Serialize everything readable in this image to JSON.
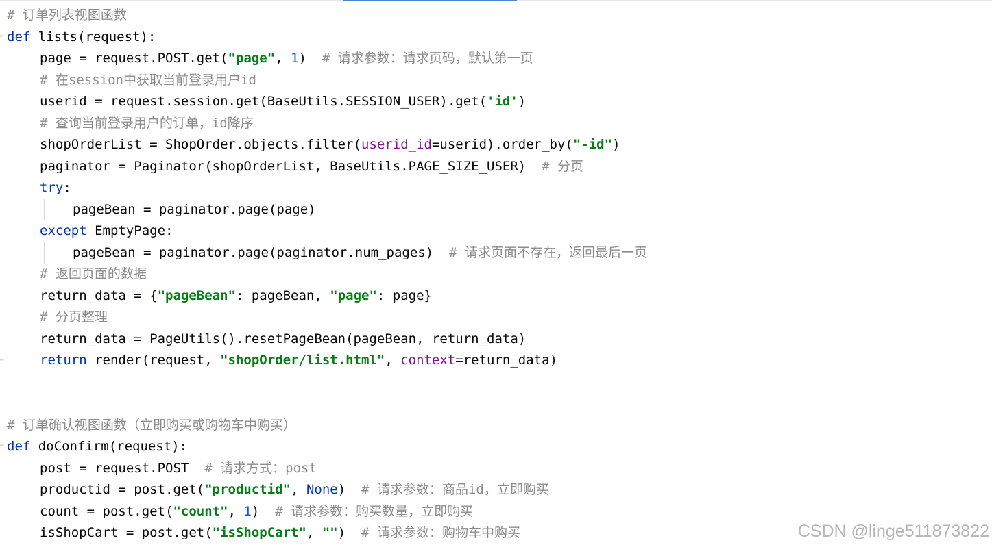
{
  "editor": {
    "lines": [
      {
        "indent": 0,
        "marker": "",
        "guide": false,
        "tokens": [
          {
            "t": "# ",
            "c": "cmt-en"
          },
          {
            "t": "订单列表视图函数",
            "c": "cmt"
          }
        ]
      },
      {
        "indent": 0,
        "marker": "fold",
        "guide": false,
        "tokens": [
          {
            "t": "def",
            "c": "kw"
          },
          {
            "t": " lists(request):",
            "c": ""
          }
        ]
      },
      {
        "indent": 1,
        "marker": "",
        "guide": false,
        "tokens": [
          {
            "t": "page = request.POST.get(",
            "c": ""
          },
          {
            "t": "\"page\"",
            "c": "str"
          },
          {
            "t": ", ",
            "c": ""
          },
          {
            "t": "1",
            "c": "num"
          },
          {
            "t": ")  ",
            "c": ""
          },
          {
            "t": "# ",
            "c": "cmt-en"
          },
          {
            "t": "请求参数：请求页码，默认第一页",
            "c": "cmt"
          }
        ]
      },
      {
        "indent": 1,
        "marker": "",
        "guide": false,
        "tokens": [
          {
            "t": "# ",
            "c": "cmt-en"
          },
          {
            "t": "在",
            "c": "cmt"
          },
          {
            "t": "session",
            "c": "cmt-en"
          },
          {
            "t": "中获取当前登录用户",
            "c": "cmt"
          },
          {
            "t": "id",
            "c": "cmt-en"
          }
        ]
      },
      {
        "indent": 1,
        "marker": "",
        "guide": false,
        "tokens": [
          {
            "t": "userid = request.session.get(BaseUtils.SESSION_USER).get(",
            "c": ""
          },
          {
            "t": "'id'",
            "c": "str"
          },
          {
            "t": ")",
            "c": ""
          }
        ]
      },
      {
        "indent": 1,
        "marker": "",
        "guide": false,
        "tokens": [
          {
            "t": "# ",
            "c": "cmt-en"
          },
          {
            "t": "查询当前登录用户的订单，",
            "c": "cmt"
          },
          {
            "t": "id",
            "c": "cmt-en"
          },
          {
            "t": "降序",
            "c": "cmt"
          }
        ]
      },
      {
        "indent": 1,
        "marker": "",
        "guide": false,
        "tokens": [
          {
            "t": "shopOrderList = ShopOrder.objects.filter(",
            "c": ""
          },
          {
            "t": "userid_id",
            "c": "prm"
          },
          {
            "t": "=userid).order_by(",
            "c": ""
          },
          {
            "t": "\"-id\"",
            "c": "str"
          },
          {
            "t": ")",
            "c": ""
          }
        ]
      },
      {
        "indent": 1,
        "marker": "",
        "guide": false,
        "tokens": [
          {
            "t": "paginator = Paginator(shopOrderList, BaseUtils.PAGE_SIZE_USER)  ",
            "c": ""
          },
          {
            "t": "# ",
            "c": "cmt-en"
          },
          {
            "t": "分页",
            "c": "cmt"
          }
        ]
      },
      {
        "indent": 1,
        "marker": "",
        "guide": false,
        "tokens": [
          {
            "t": "try",
            "c": "kw"
          },
          {
            "t": ":",
            "c": ""
          }
        ]
      },
      {
        "indent": 2,
        "marker": "",
        "guide": true,
        "tokens": [
          {
            "t": "pageBean = paginator.page(page)",
            "c": ""
          }
        ]
      },
      {
        "indent": 1,
        "marker": "",
        "guide": false,
        "tokens": [
          {
            "t": "except",
            "c": "kw"
          },
          {
            "t": " EmptyPage:",
            "c": ""
          }
        ]
      },
      {
        "indent": 2,
        "marker": "",
        "guide": true,
        "tokens": [
          {
            "t": "pageBean = paginator.page(paginator.num_pages)  ",
            "c": ""
          },
          {
            "t": "# ",
            "c": "cmt-en"
          },
          {
            "t": "请求页面不存在，返回最后一页",
            "c": "cmt"
          }
        ]
      },
      {
        "indent": 1,
        "marker": "",
        "guide": false,
        "tokens": [
          {
            "t": "# ",
            "c": "cmt-en"
          },
          {
            "t": "返回页面的数据",
            "c": "cmt"
          }
        ]
      },
      {
        "indent": 1,
        "marker": "",
        "guide": false,
        "tokens": [
          {
            "t": "return_data = {",
            "c": ""
          },
          {
            "t": "\"pageBean\"",
            "c": "str"
          },
          {
            "t": ": pageBean, ",
            "c": ""
          },
          {
            "t": "\"page\"",
            "c": "str"
          },
          {
            "t": ": page}",
            "c": ""
          }
        ]
      },
      {
        "indent": 1,
        "marker": "",
        "guide": false,
        "tokens": [
          {
            "t": "# ",
            "c": "cmt-en"
          },
          {
            "t": "分页整理",
            "c": "cmt"
          }
        ]
      },
      {
        "indent": 1,
        "marker": "",
        "guide": false,
        "tokens": [
          {
            "t": "return_data = PageUtils().resetPageBean(pageBean, return_data)",
            "c": ""
          }
        ]
      },
      {
        "indent": 1,
        "marker": "fold-end",
        "guide": false,
        "tokens": [
          {
            "t": "return",
            "c": "kw"
          },
          {
            "t": " render(request, ",
            "c": ""
          },
          {
            "t": "\"shopOrder/list.html\"",
            "c": "str"
          },
          {
            "t": ", ",
            "c": ""
          },
          {
            "t": "context",
            "c": "prm"
          },
          {
            "t": "=return_data)",
            "c": ""
          }
        ]
      },
      {
        "indent": 0,
        "marker": "",
        "guide": false,
        "tokens": []
      },
      {
        "indent": 0,
        "marker": "",
        "guide": false,
        "tokens": []
      },
      {
        "indent": 0,
        "marker": "",
        "guide": false,
        "tokens": [
          {
            "t": "# ",
            "c": "cmt-en"
          },
          {
            "t": "订单确认视图函数（立即购买或购物车中购买）",
            "c": "cmt"
          }
        ]
      },
      {
        "indent": 0,
        "marker": "fold",
        "guide": false,
        "tokens": [
          {
            "t": "def",
            "c": "kw"
          },
          {
            "t": " doConfirm(request):",
            "c": ""
          }
        ]
      },
      {
        "indent": 1,
        "marker": "",
        "guide": false,
        "tokens": [
          {
            "t": "post = request.POST  ",
            "c": ""
          },
          {
            "t": "# ",
            "c": "cmt-en"
          },
          {
            "t": "请求方式：",
            "c": "cmt"
          },
          {
            "t": "post",
            "c": "cmt-en"
          }
        ]
      },
      {
        "indent": 1,
        "marker": "",
        "guide": false,
        "tokens": [
          {
            "t": "productid = post.get(",
            "c": ""
          },
          {
            "t": "\"productid\"",
            "c": "str"
          },
          {
            "t": ", ",
            "c": ""
          },
          {
            "t": "None",
            "c": "kw"
          },
          {
            "t": ")  ",
            "c": ""
          },
          {
            "t": "# ",
            "c": "cmt-en"
          },
          {
            "t": "请求参数：商品",
            "c": "cmt"
          },
          {
            "t": "id",
            "c": "cmt-en"
          },
          {
            "t": "，立即购买",
            "c": "cmt"
          }
        ]
      },
      {
        "indent": 1,
        "marker": "",
        "guide": false,
        "tokens": [
          {
            "t": "count = post.get(",
            "c": ""
          },
          {
            "t": "\"count\"",
            "c": "str"
          },
          {
            "t": ", ",
            "c": ""
          },
          {
            "t": "1",
            "c": "num"
          },
          {
            "t": ")  ",
            "c": ""
          },
          {
            "t": "# ",
            "c": "cmt-en"
          },
          {
            "t": "请求参数：购买数量，立即购买",
            "c": "cmt"
          }
        ]
      },
      {
        "indent": 1,
        "marker": "",
        "guide": false,
        "tokens": [
          {
            "t": "isShopCart = post.get(",
            "c": ""
          },
          {
            "t": "\"isShopCart\"",
            "c": "str"
          },
          {
            "t": ", ",
            "c": ""
          },
          {
            "t": "\"\"",
            "c": "str"
          },
          {
            "t": ")  ",
            "c": ""
          },
          {
            "t": "# ",
            "c": "cmt-en"
          },
          {
            "t": "请求参数：购物车中购买",
            "c": "cmt"
          }
        ]
      }
    ]
  },
  "watermark": {
    "text": "CSDN @linge511873822"
  }
}
